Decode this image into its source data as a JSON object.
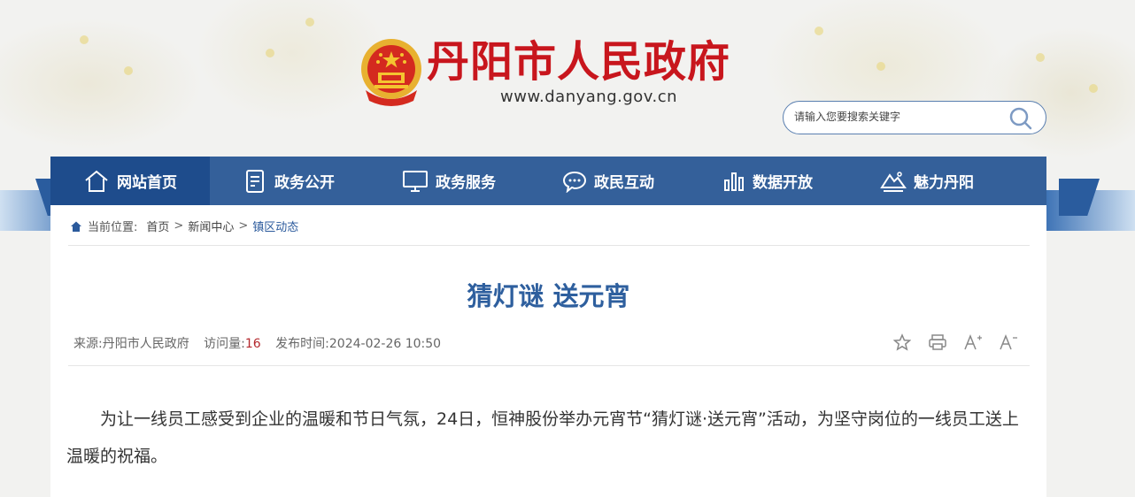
{
  "site": {
    "title": "丹阳市人民政府",
    "url": "www.danyang.gov.cn",
    "brand_color": "#c8161d"
  },
  "search": {
    "placeholder": "请输入您要搜索关键字",
    "icon": "search-icon"
  },
  "nav": {
    "items": [
      {
        "label": "网站首页",
        "icon": "home-icon",
        "active": true
      },
      {
        "label": "政务公开",
        "icon": "document-icon"
      },
      {
        "label": "政务服务",
        "icon": "monitor-icon"
      },
      {
        "label": "政民互动",
        "icon": "chat-icon"
      },
      {
        "label": "数据开放",
        "icon": "bar-chart-icon"
      },
      {
        "label": "魅力丹阳",
        "icon": "landscape-icon"
      }
    ],
    "bg_color": "#34609a",
    "active_color": "#1e4c8c"
  },
  "breadcrumb": {
    "prefix": "当前位置:",
    "items": [
      "首页",
      "新闻中心",
      "镇区动态"
    ],
    "separator": ">"
  },
  "article": {
    "title": "猜灯谜 送元宵",
    "source_label": "来源:",
    "source": "丹阳市人民政府",
    "views_label": "访问量:",
    "views": "16",
    "published_label": "发布时间:",
    "published": "2024-02-26 10:50",
    "tools": [
      {
        "name": "favorite-star-icon",
        "glyph": "☆"
      },
      {
        "name": "print-icon",
        "glyph": "⎙"
      },
      {
        "name": "font-increase-icon",
        "glyph": "A⁺"
      },
      {
        "name": "font-decrease-icon",
        "glyph": "A⁻"
      }
    ],
    "paragraph": "为让一线员工感受到企业的温暖和节日气氛，24日，恒神股份举办元宵节“猜灯谜·送元宵”活动，为坚守岗位的一线员工送上温暖的祝福。"
  }
}
